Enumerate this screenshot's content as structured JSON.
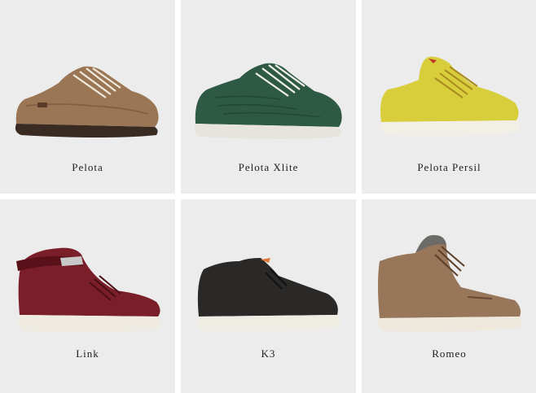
{
  "products": [
    {
      "name": "Pelota",
      "icon": "brown-lace-up-sneaker",
      "color": "#9a7654"
    },
    {
      "name": "Pelota Xlite",
      "icon": "green-lace-up-sneaker",
      "color": "#2e5a45"
    },
    {
      "name": "Pelota Persil",
      "icon": "yellow-mid-top-sneaker",
      "color": "#d8ce3c"
    },
    {
      "name": "Link",
      "icon": "burgundy-high-top-strap-sneaker",
      "color": "#7a1f2a"
    },
    {
      "name": "K3",
      "icon": "black-chukka-sneaker",
      "color": "#2a2927"
    },
    {
      "name": "Romeo",
      "icon": "tan-fur-lined-boot",
      "color": "#97765a"
    }
  ]
}
